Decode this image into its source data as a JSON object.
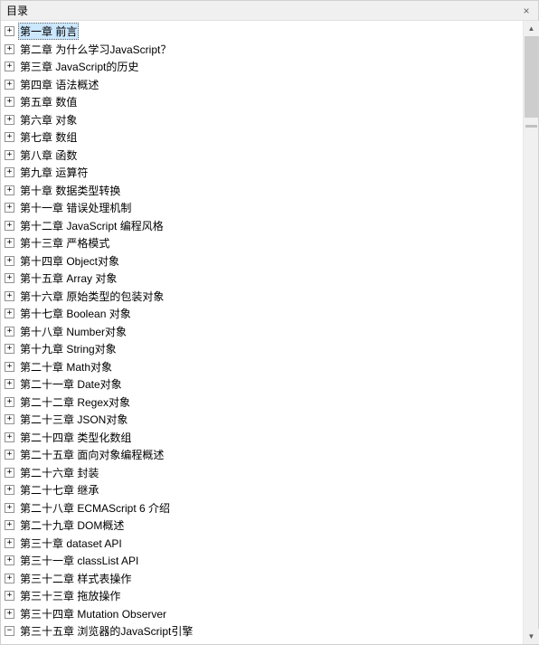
{
  "window": {
    "title": "目录",
    "close_label": "×"
  },
  "tree": {
    "items": [
      {
        "label": "第一章 前言",
        "selected": true,
        "expand": "+"
      },
      {
        "label": "第二章 为什么学习JavaScript？",
        "expand": "+"
      },
      {
        "label": "第三章 JavaScript的历史",
        "expand": "+"
      },
      {
        "label": "第四章 语法概述",
        "expand": "+"
      },
      {
        "label": "第五章 数值",
        "expand": "+"
      },
      {
        "label": "第六章 对象",
        "expand": "+"
      },
      {
        "label": "第七章 数组",
        "expand": "+"
      },
      {
        "label": "第八章 函数",
        "expand": "+"
      },
      {
        "label": "第九章 运算符",
        "expand": "+"
      },
      {
        "label": "第十章 数据类型转换",
        "expand": "+"
      },
      {
        "label": "第十一章 错误处理机制",
        "expand": "+"
      },
      {
        "label": "第十二章 JavaScript 编程风格",
        "expand": "+"
      },
      {
        "label": "第十三章 严格模式",
        "expand": "+"
      },
      {
        "label": "第十四章 Object对象",
        "expand": "+"
      },
      {
        "label": "第十五章 Array 对象",
        "expand": "+"
      },
      {
        "label": "第十六章 原始类型的包装对象",
        "expand": "+"
      },
      {
        "label": "第十七章 Boolean 对象",
        "expand": "+"
      },
      {
        "label": "第十八章 Number对象",
        "expand": "+"
      },
      {
        "label": "第十九章 String对象",
        "expand": "+"
      },
      {
        "label": "第二十章 Math对象",
        "expand": "+"
      },
      {
        "label": "第二十一章 Date对象",
        "expand": "+"
      },
      {
        "label": "第二十二章 Regex对象",
        "expand": "+"
      },
      {
        "label": "第二十三章 JSON对象",
        "expand": "+"
      },
      {
        "label": "第二十四章 类型化数组",
        "expand": "+"
      },
      {
        "label": "第二十五章 面向对象编程概述",
        "expand": "+"
      },
      {
        "label": "第二十六章 封装",
        "expand": "+"
      },
      {
        "label": "第二十七章 继承",
        "expand": "+"
      },
      {
        "label": "第二十八章 ECMAScript 6 介绍",
        "expand": "+"
      },
      {
        "label": "第二十九章 DOM概述",
        "expand": "+"
      },
      {
        "label": "第三十章 dataset API",
        "expand": "+"
      },
      {
        "label": "第三十一章 classList API",
        "expand": "+"
      },
      {
        "label": "第三十二章 样式表操作",
        "expand": "+"
      },
      {
        "label": "第三十三章 拖放操作",
        "expand": "+"
      },
      {
        "label": "第三十四章 Mutation Observer",
        "expand": "+"
      },
      {
        "label": "第三十五章 浏览器的JavaScript引擎",
        "expand": "−"
      }
    ]
  },
  "scrollbar": {
    "up": "▲",
    "down": "▼"
  }
}
